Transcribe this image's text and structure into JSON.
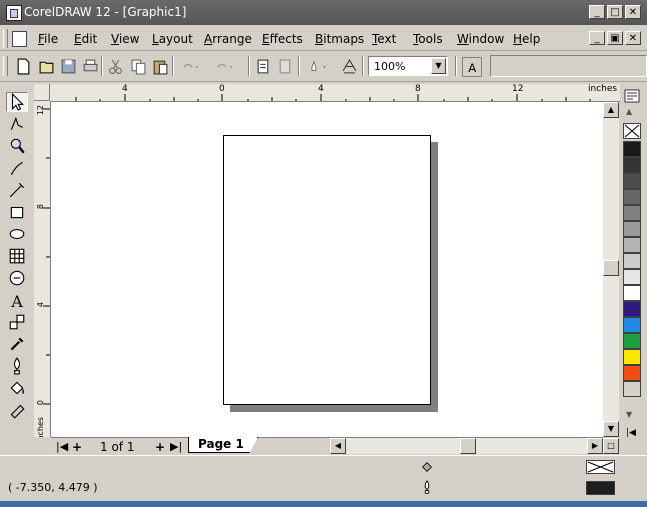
{
  "window": {
    "title": "CorelDRAW 12 - [Graphic1]",
    "controls": [
      "_",
      "□",
      "✕"
    ],
    "doc_controls": [
      "_",
      "▣",
      "✕"
    ]
  },
  "menu": {
    "items": [
      {
        "label": "File",
        "key": "F",
        "rest": "ile"
      },
      {
        "label": "Edit",
        "key": "E",
        "rest": "dit"
      },
      {
        "label": "View",
        "key": "V",
        "rest": "iew"
      },
      {
        "label": "Layout",
        "key": "L",
        "rest": "ayout"
      },
      {
        "label": "Arrange",
        "key": "A",
        "rest": "rrange"
      },
      {
        "label": "Effects",
        "key": "E",
        "rest": "ffects"
      },
      {
        "label": "Bitmaps",
        "key": "B",
        "rest": "itmaps"
      },
      {
        "label": "Text",
        "key": "T",
        "rest": "ext"
      },
      {
        "label": "Tools",
        "key": "T",
        "rest": "ools"
      },
      {
        "label": "Window",
        "key": "W",
        "rest": "indow"
      },
      {
        "label": "Help",
        "key": "H",
        "rest": "elp"
      }
    ]
  },
  "toolbar": {
    "zoom_value": "100%",
    "icons": [
      "new-icon",
      "open-icon",
      "save-icon",
      "print-icon",
      "cut-icon",
      "copy-icon",
      "paste-icon",
      "undo-icon",
      "redo-icon",
      "import-icon",
      "export-icon",
      "launcher-icon",
      "corel-online-icon"
    ]
  },
  "toolbox": {
    "tools": [
      "pick-tool-icon",
      "shape-tool-icon",
      "zoom-tool-icon",
      "freehand-tool-icon",
      "smart-fill-icon",
      "rectangle-tool-icon",
      "ellipse-tool-icon",
      "graph-paper-icon",
      "basic-shapes-icon",
      "text-tool-icon",
      "interactive-blend-icon",
      "eyedropper-icon",
      "outline-tool-icon",
      "fill-tool-icon",
      "interactive-fill-icon"
    ]
  },
  "ruler": {
    "unit": "inches",
    "h_ticks": [
      "4",
      "0",
      "4",
      "8",
      "12"
    ],
    "v_ticks": [
      "12",
      "8",
      "4",
      "0"
    ]
  },
  "navigation": {
    "page_count": "1 of 1",
    "current_tab": "Page 1"
  },
  "palette": {
    "colors": [
      "#ffffff",
      "#1a1a1a",
      "#333333",
      "#4d4d4d",
      "#666666",
      "#808080",
      "#999999",
      "#b3b3b3",
      "#cccccc",
      "#e6e6e6",
      "#ffffff",
      "#2e1a7e",
      "#1e88e5",
      "#1b9e3e",
      "#ffe600",
      "#f44b0f"
    ]
  },
  "status": {
    "coordinates": "( -7.350, 4.479 )"
  }
}
